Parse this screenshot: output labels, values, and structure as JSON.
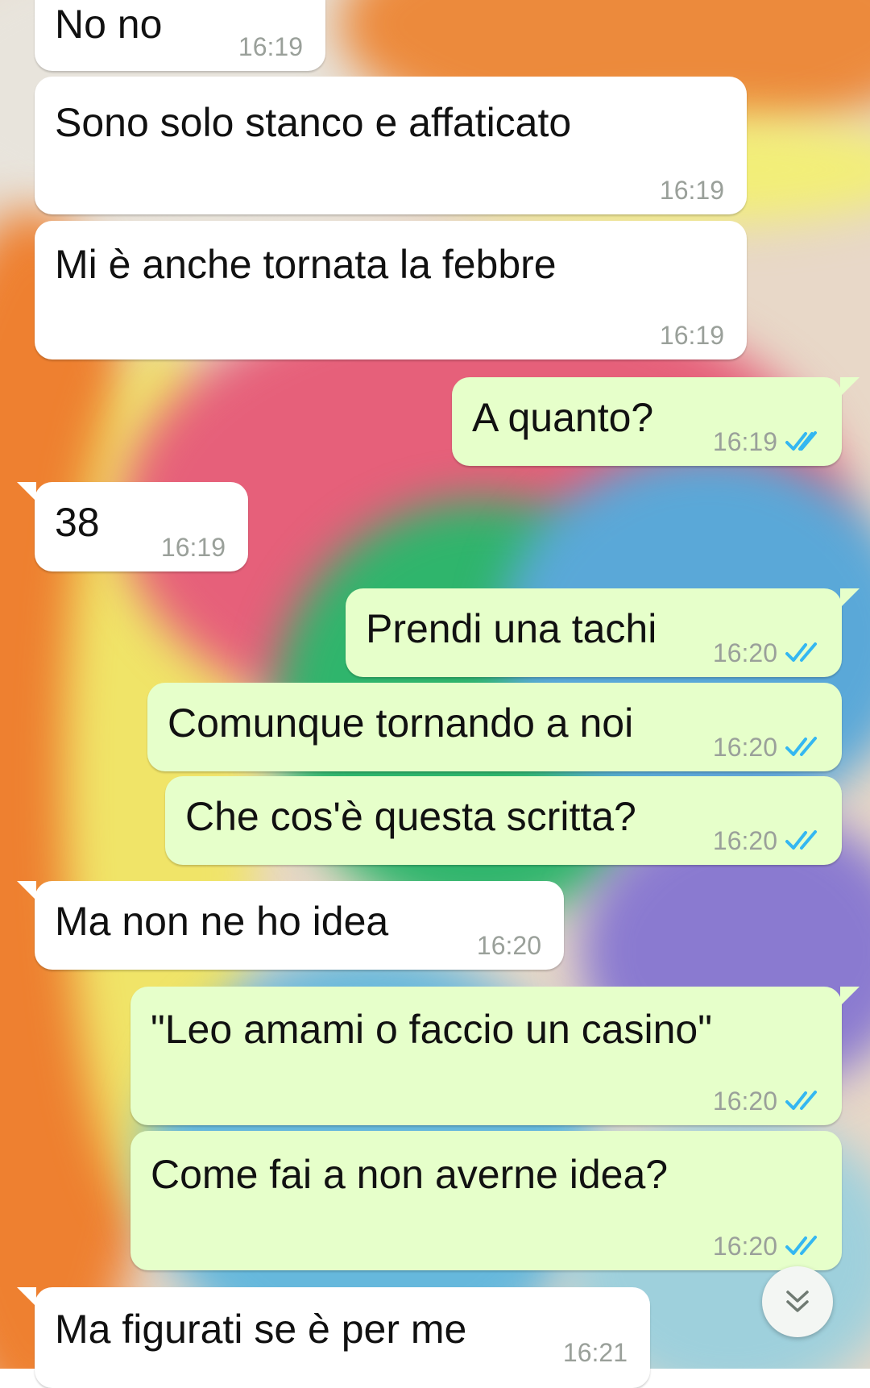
{
  "messages": [
    {
      "direction": "in",
      "text": "No no",
      "time": "16:19"
    },
    {
      "direction": "in",
      "text": "Sono solo stanco e affaticato",
      "time": "16:19"
    },
    {
      "direction": "in",
      "text": "Mi è anche tornata la febbre",
      "time": "16:19"
    },
    {
      "direction": "out",
      "text": "A quanto?",
      "time": "16:19",
      "status": "read"
    },
    {
      "direction": "in",
      "text": "38",
      "time": "16:19"
    },
    {
      "direction": "out",
      "text": "Prendi una tachi",
      "time": "16:20",
      "status": "read"
    },
    {
      "direction": "out",
      "text": "Comunque tornando a noi",
      "time": "16:20",
      "status": "read"
    },
    {
      "direction": "out",
      "text": "Che cos'è questa scritta?",
      "time": "16:20",
      "status": "read"
    },
    {
      "direction": "in",
      "text": "Ma non ne ho idea",
      "time": "16:20"
    },
    {
      "direction": "out",
      "text": "\"Leo amami o faccio un casino\"",
      "time": "16:20",
      "status": "read"
    },
    {
      "direction": "out",
      "text": "Come fai a non averne idea?",
      "time": "16:20",
      "status": "read"
    },
    {
      "direction": "in",
      "text": "Ma figurati se è per me",
      "time": "16:21"
    }
  ],
  "icons": {
    "read_receipt": "double-check-icon",
    "scroll_down": "chevron-double-down-icon"
  },
  "colors": {
    "incoming_bubble": "#ffffff",
    "outgoing_bubble": "#e6ffca",
    "read_tick": "#34b7f1",
    "time_text": "#9aa09a"
  }
}
